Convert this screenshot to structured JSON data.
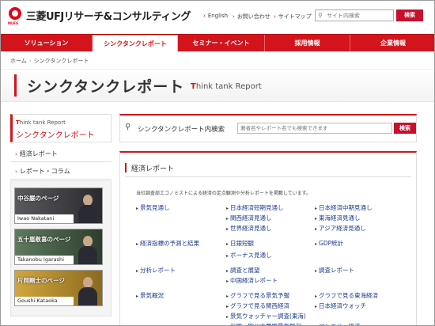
{
  "header": {
    "logo_text": "三菱UFJリサーチ&コンサルティング",
    "logo_sub": "MUFG",
    "util_links": [
      "English",
      "お問い合わせ",
      "サイトマップ"
    ],
    "search_placeholder": "サイト内検索",
    "search_button": "検索"
  },
  "nav": {
    "items": [
      "ソリューション",
      "シンクタンクレポート",
      "セミナー・イベント",
      "採用情報",
      "企業情報"
    ]
  },
  "breadcrumb": {
    "home": "ホーム",
    "sep": "›",
    "current": "シンクタンクレポート"
  },
  "page": {
    "title_jp": "シンクタンクレポート",
    "title_en_first": "T",
    "title_en_rest": "hink tank Report"
  },
  "sidebar": {
    "head_en_first": "T",
    "head_en_rest": "hink tank Report",
    "head_jp": "シンクタンクレポート",
    "links": [
      "経済レポート",
      "レポート・コラム"
    ],
    "banners": [
      {
        "label": "中谷巌のページ",
        "name": "Iwao Nakatani",
        "bg": "#3c3c40"
      },
      {
        "label": "五十嵐敬喜のページ",
        "name": "Takanobu Igarashi",
        "bg": "#3f5240"
      },
      {
        "label": "片岡剛士のページ",
        "name": "Goushi Kataoka",
        "bg": "#b38a2a"
      }
    ]
  },
  "report_search": {
    "label": "シンクタンクレポート内検索",
    "placeholder": "著者名やレポート名でも検索できます",
    "button": "検索"
  },
  "section": {
    "title": "経済レポート",
    "description": "当社調査部エコノミストによる経済の定点観測や分析レポートを掲載しています。",
    "rows": [
      [
        "景気見通し",
        "日本経済短期見通し",
        "日本経済中期見通し"
      ],
      [
        "",
        "関西経済見通し",
        "東海経済見通し"
      ],
      [
        "",
        "世界経済見通し",
        "アジア経済見通し"
      ],
      [
        "経済指標の予測と結果",
        "日銀短観",
        "GDP統計"
      ],
      [
        "",
        "ボーナス見通し",
        ""
      ],
      [
        "分析レポート",
        "調査と展望",
        "調査レポート"
      ],
      [
        "",
        "中国経済レポート",
        ""
      ],
      [
        "景気概況",
        "グラフで見る景気予報",
        "グラフで見る東海経済"
      ],
      [
        "",
        "グラフで見る関西経済",
        "日本経済ウォッチ"
      ],
      [
        "",
        "景気ウォッチャー調査(東海)",
        ""
      ],
      [
        "",
        "米国・欧州主要国景気概況",
        "マンスリー経済"
      ]
    ]
  },
  "colors": {
    "brand_red": "#d3141c",
    "link_blue": "#1a3a8a"
  },
  "icons": {
    "search": "search-icon",
    "arrow": "arrow-right-icon"
  }
}
